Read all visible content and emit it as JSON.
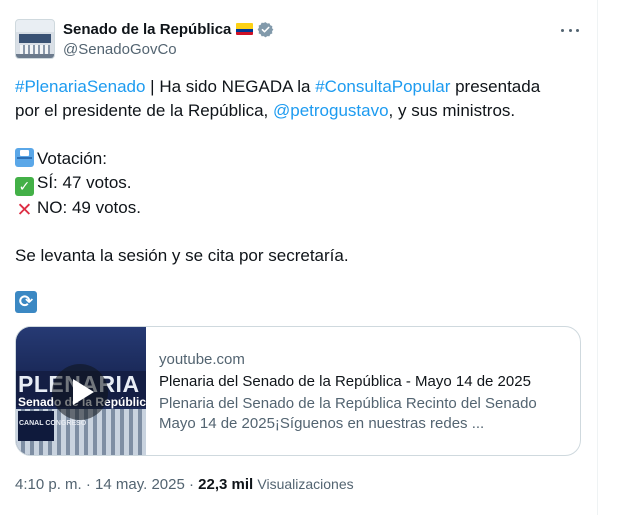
{
  "author": {
    "name": "Senado de la República",
    "handle": "@SenadoGovCo",
    "flag_icon": "colombia-flag-icon",
    "verified_icon": "verified-badge-icon"
  },
  "tweet": {
    "line1": {
      "hashtag1": "#PlenariaSenado",
      "text1": " | Ha sido NEGADA la ",
      "hashtag2": "#ConsultaPopular",
      "text2": " presentada"
    },
    "line2": {
      "text1": "por el presidente de la República, ",
      "mention": "@petrogustavo",
      "text2": ", y sus ministros."
    },
    "vote_label": "Votación:",
    "yes_line": "SÍ: 47 votos.",
    "no_line": "NO: 49 votos.",
    "closing": "Se levanta la sesión y se cita por secretaría.",
    "repeat_icon_glyph": "🔄"
  },
  "card": {
    "domain": "youtube.com",
    "title": "Plenaria del Senado de la República - Mayo 14 de 2025",
    "description": "Plenaria del Senado de la República Recinto del Senado Mayo 14 de 2025¡Síguenos en nuestras redes ...",
    "thumbnail": {
      "title": "PLENARIA",
      "subtitle": "Senado de la República",
      "chip": "CANAL CONGRESO"
    }
  },
  "footer": {
    "time": "4:10 p. m.",
    "separator": "·",
    "date": "14 may. 2025",
    "views_count": "22,3 mil",
    "views_label": "Visualizaciones"
  },
  "colors": {
    "link": "#1d9bf0",
    "text": "#0f1419",
    "secondary": "#536471",
    "border": "#cfd9de"
  }
}
